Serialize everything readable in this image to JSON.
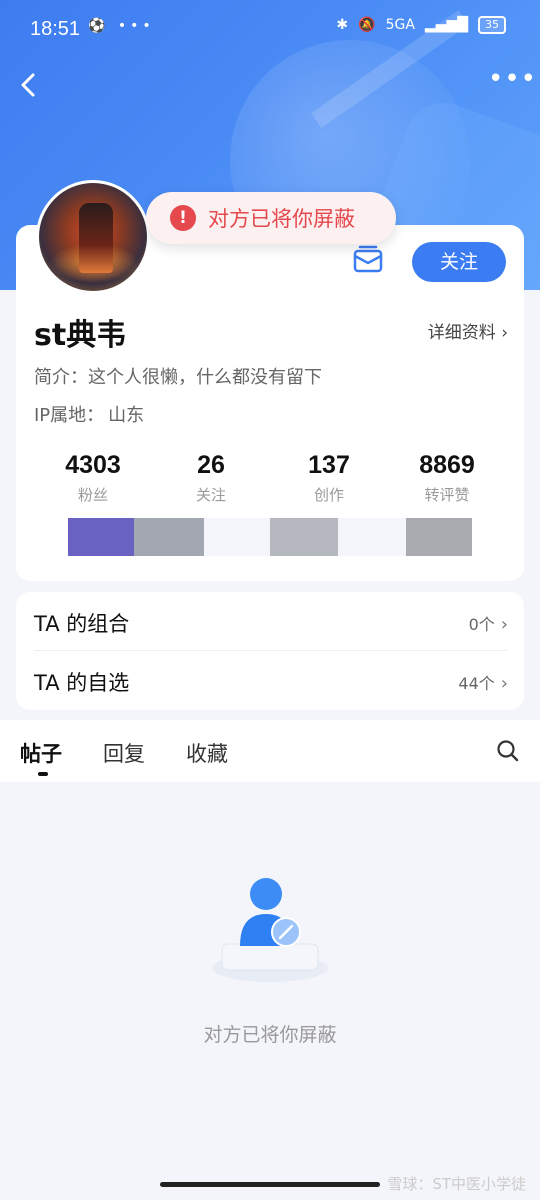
{
  "status_bar": {
    "time": "18:51",
    "left_icons": "⚽ •••",
    "network": "5GA",
    "battery": "35"
  },
  "toast": {
    "text": "对方已将你屏蔽"
  },
  "profile": {
    "username": "st典韦",
    "detail_link": "详细资料",
    "bio": "简介：这个人很懒，什么都没有留下",
    "ip_label": "IP属地：",
    "ip_value": "山东",
    "follow_label": "关注",
    "stats": [
      {
        "value": "4303",
        "label": "粉丝"
      },
      {
        "value": "26",
        "label": "关注"
      },
      {
        "value": "137",
        "label": "创作"
      },
      {
        "value": "8869",
        "label": "转评赞"
      }
    ]
  },
  "lists": [
    {
      "title": "TA 的组合",
      "count": "0个"
    },
    {
      "title": "TA 的自选",
      "count": "44个"
    }
  ],
  "tabs": [
    {
      "label": "帖子",
      "active": true
    },
    {
      "label": "回复",
      "active": false
    },
    {
      "label": "收藏",
      "active": false
    }
  ],
  "empty_state": {
    "text": "对方已将你屏蔽"
  },
  "watermark": "雪球：ST中医小学徒",
  "colors": {
    "accent": "#3b7cf2",
    "alert": "#e5484d",
    "background": "#f3f5fa"
  }
}
